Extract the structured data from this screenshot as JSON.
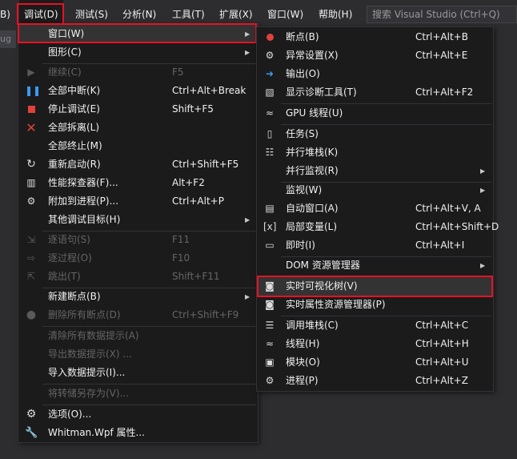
{
  "menubar": {
    "items": [
      "B)",
      "调试(D)",
      "测试(S)",
      "分析(N)",
      "工具(T)",
      "扩展(X)",
      "窗口(W)",
      "帮助(H)"
    ],
    "search_placeholder": "搜索 Visual Studio (Ctrl+Q)",
    "tab_stub": "ug"
  },
  "debug_menu": [
    {
      "label": "窗口(W)",
      "shortcut": "",
      "submenu": true,
      "enabled": true,
      "icon": ""
    },
    {
      "label": "图形(C)",
      "shortcut": "",
      "submenu": true,
      "enabled": true,
      "icon": ""
    },
    {
      "label": "继续(C)",
      "shortcut": "F5",
      "submenu": false,
      "enabled": false,
      "icon": "play-icon"
    },
    {
      "label": "全部中断(K)",
      "shortcut": "Ctrl+Alt+Break",
      "submenu": false,
      "enabled": true,
      "icon": "pause-icon"
    },
    {
      "label": "停止调试(E)",
      "shortcut": "Shift+F5",
      "submenu": false,
      "enabled": true,
      "icon": "stop-icon"
    },
    {
      "label": "全部拆离(L)",
      "shortcut": "",
      "submenu": false,
      "enabled": true,
      "icon": "detach-icon"
    },
    {
      "label": "全部终止(M)",
      "shortcut": "",
      "submenu": false,
      "enabled": true,
      "icon": ""
    },
    {
      "label": "重新启动(R)",
      "shortcut": "Ctrl+Shift+F5",
      "submenu": false,
      "enabled": true,
      "icon": "restart-icon"
    },
    {
      "label": "性能探查器(F)...",
      "shortcut": "Alt+F2",
      "submenu": false,
      "enabled": true,
      "icon": "profiler-icon"
    },
    {
      "label": "附加到进程(P)...",
      "shortcut": "Ctrl+Alt+P",
      "submenu": false,
      "enabled": true,
      "icon": "attach-icon"
    },
    {
      "label": "其他调试目标(H)",
      "shortcut": "",
      "submenu": true,
      "enabled": true,
      "icon": ""
    },
    {
      "label": "逐语句(S)",
      "shortcut": "F11",
      "submenu": false,
      "enabled": false,
      "icon": "step-into-icon"
    },
    {
      "label": "逐过程(O)",
      "shortcut": "F10",
      "submenu": false,
      "enabled": false,
      "icon": "step-over-icon"
    },
    {
      "label": "跳出(T)",
      "shortcut": "Shift+F11",
      "submenu": false,
      "enabled": false,
      "icon": "step-out-icon"
    },
    {
      "label": "新建断点(B)",
      "shortcut": "",
      "submenu": true,
      "enabled": true,
      "icon": ""
    },
    {
      "label": "删除所有断点(D)",
      "shortcut": "Ctrl+Shift+F9",
      "submenu": false,
      "enabled": false,
      "icon": "delete-breakpoints-icon"
    },
    {
      "label": "清除所有数据提示(A)",
      "shortcut": "",
      "submenu": false,
      "enabled": false,
      "icon": ""
    },
    {
      "label": "导出数据提示(X) ...",
      "shortcut": "",
      "submenu": false,
      "enabled": false,
      "icon": ""
    },
    {
      "label": "导入数据提示(I)...",
      "shortcut": "",
      "submenu": false,
      "enabled": true,
      "icon": ""
    },
    {
      "label": "将转储另存为(V)...",
      "shortcut": "",
      "submenu": false,
      "enabled": false,
      "icon": ""
    },
    {
      "label": "选项(O)...",
      "shortcut": "",
      "submenu": false,
      "enabled": true,
      "icon": "gear-icon"
    },
    {
      "label": "Whitman.Wpf 属性...",
      "shortcut": "",
      "submenu": false,
      "enabled": true,
      "icon": "wrench-icon"
    }
  ],
  "window_menu": [
    {
      "label": "断点(B)",
      "shortcut": "Ctrl+Alt+B",
      "submenu": false,
      "icon": "breakpoints-icon"
    },
    {
      "label": "异常设置(X)",
      "shortcut": "Ctrl+Alt+E",
      "submenu": false,
      "icon": "exception-settings-icon"
    },
    {
      "label": "输出(O)",
      "shortcut": "",
      "submenu": false,
      "icon": "output-icon"
    },
    {
      "label": "显示诊断工具(T)",
      "shortcut": "Ctrl+Alt+F2",
      "submenu": false,
      "icon": "diagnostics-icon"
    },
    {
      "label": "GPU 线程(U)",
      "shortcut": "",
      "submenu": false,
      "icon": "gpu-threads-icon"
    },
    {
      "label": "任务(S)",
      "shortcut": "",
      "submenu": false,
      "icon": "tasks-icon"
    },
    {
      "label": "并行堆栈(K)",
      "shortcut": "",
      "submenu": false,
      "icon": "parallel-stacks-icon"
    },
    {
      "label": "并行监视(R)",
      "shortcut": "",
      "submenu": true,
      "icon": ""
    },
    {
      "label": "监视(W)",
      "shortcut": "",
      "submenu": true,
      "icon": ""
    },
    {
      "label": "自动窗口(A)",
      "shortcut": "Ctrl+Alt+V, A",
      "submenu": false,
      "icon": "autos-icon"
    },
    {
      "label": "局部变量(L)",
      "shortcut": "Ctrl+Alt+Shift+D",
      "submenu": false,
      "icon": "locals-icon"
    },
    {
      "label": "即时(I)",
      "shortcut": "Ctrl+Alt+I",
      "submenu": false,
      "icon": "immediate-icon"
    },
    {
      "label": "DOM 资源管理器",
      "shortcut": "",
      "submenu": true,
      "icon": ""
    },
    {
      "label": "实时可视化树(V)",
      "shortcut": "",
      "submenu": false,
      "icon": "live-visual-tree-icon"
    },
    {
      "label": "实时属性资源管理器(P)",
      "shortcut": "",
      "submenu": false,
      "icon": "live-property-explorer-icon"
    },
    {
      "label": "调用堆栈(C)",
      "shortcut": "Ctrl+Alt+C",
      "submenu": false,
      "icon": "call-stack-icon"
    },
    {
      "label": "线程(H)",
      "shortcut": "Ctrl+Alt+H",
      "submenu": false,
      "icon": "threads-icon"
    },
    {
      "label": "模块(O)",
      "shortcut": "Ctrl+Alt+U",
      "submenu": false,
      "icon": "modules-icon"
    },
    {
      "label": "进程(P)",
      "shortcut": "Ctrl+Alt+Z",
      "submenu": false,
      "icon": "processes-icon"
    }
  ],
  "colors": {
    "menu_bg": "#1b1b1c",
    "highlight_border": "#e81123",
    "disabled_text": "#656565",
    "icon_blue": "#3c9bf0",
    "icon_red": "#e0413a"
  }
}
